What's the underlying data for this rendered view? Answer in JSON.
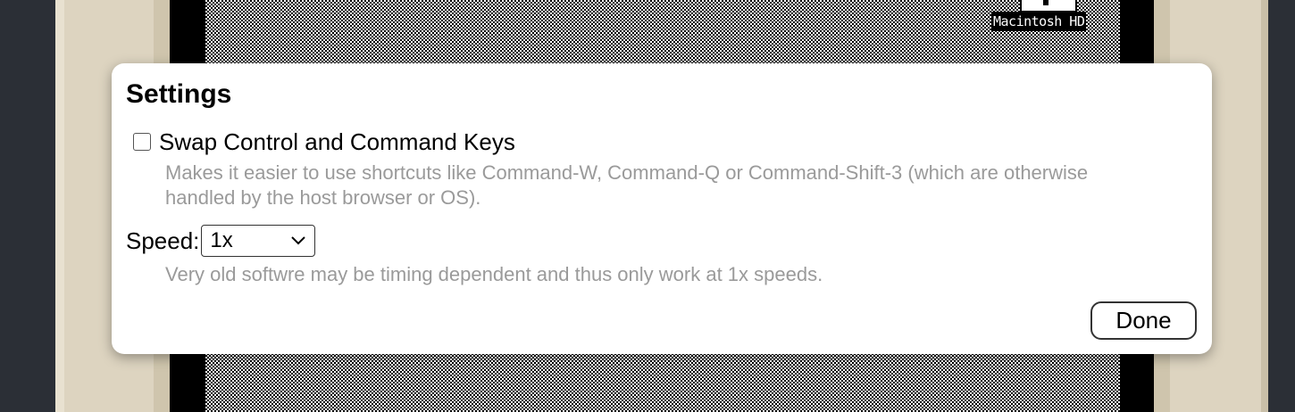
{
  "desktop": {
    "disk_label": "Macintosh HD"
  },
  "settings": {
    "title": "Settings",
    "swap_keys": {
      "label": "Swap Control and Command Keys",
      "checked": false,
      "help": "Makes it easier to use shortcuts like Command-W, Command-Q or Command-Shift-3 (which are otherwise handled by the host browser or OS)."
    },
    "speed": {
      "label": "Speed:",
      "selected": "1x",
      "help": "Very old softwre may be timing dependent and thus only work at 1x speeds."
    },
    "done_label": "Done"
  },
  "icons": {
    "disk": "hard-disk-icon",
    "dropdown": "chevron-down-icon"
  }
}
